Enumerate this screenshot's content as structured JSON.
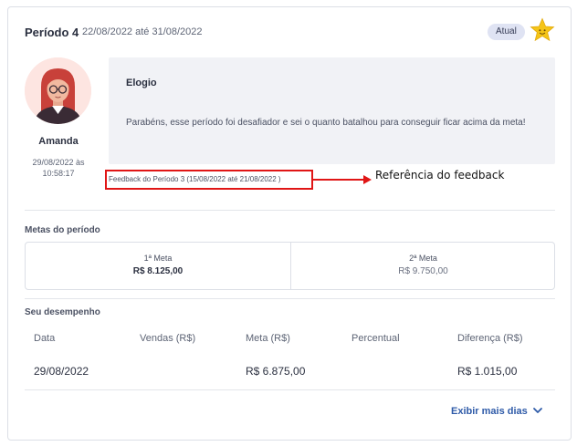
{
  "period": {
    "title": "Período 4",
    "dates": "22/08/2022 até 31/08/2022",
    "badge": "Atual",
    "badge_color": "#dfe3f3",
    "star_color": "#f5c518"
  },
  "author": {
    "name": "Amanda",
    "date": "29/08/2022 às",
    "time": "10:58:17"
  },
  "feedback": {
    "type": "Elogio",
    "text": "Parabéns, esse período foi desafiador e sei o quanto batalhou para conseguir ficar acima da meta!"
  },
  "reference": {
    "link": "Feedback do Período 3 (15/08/2022 até 21/08/2022 )",
    "annotation": "Referência do feedback",
    "highlight_color": "#e01616"
  },
  "goals": {
    "title": "Metas do período",
    "items": [
      {
        "label": "1ª Meta",
        "value": "R$ 8.125,00"
      },
      {
        "label": "2ª Meta",
        "value": "R$ 9.750,00"
      }
    ]
  },
  "performance": {
    "title": "Seu desempenho",
    "columns": [
      "Data",
      "Vendas (R$)",
      "Meta (R$)",
      "Percentual",
      "Diferença (R$)"
    ],
    "rows": [
      [
        "29/08/2022",
        "",
        "R$ 6.875,00",
        "",
        "R$ 1.015,00"
      ]
    ]
  },
  "show_more": "Exibir mais dias",
  "accent_color": "#2e5aa8"
}
